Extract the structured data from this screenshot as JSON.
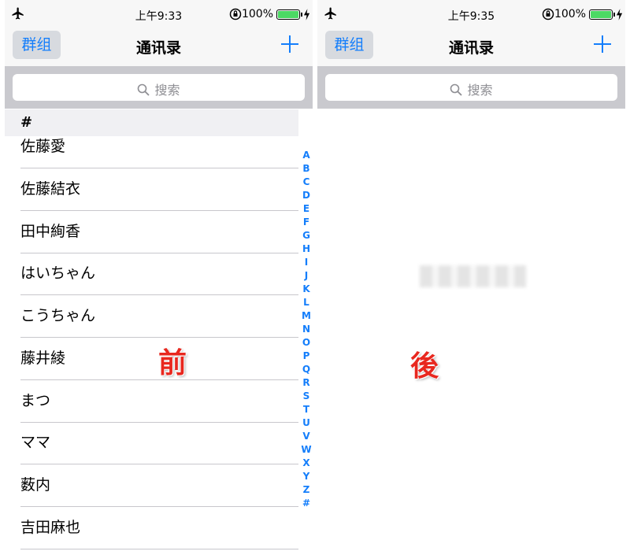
{
  "before": {
    "status": {
      "time": "上午9:33",
      "battery": "100%"
    },
    "nav": {
      "left_button": "群组",
      "title": "通讯录",
      "add_icon": "plus-icon"
    },
    "search": {
      "placeholder": "搜索"
    },
    "section_header": "#",
    "contacts": [
      "佐藤愛",
      "佐藤結衣",
      "田中絢香",
      "はいちゃん",
      "こうちゃん",
      "藤井綾",
      "まつ",
      "ママ",
      "薮内",
      "吉田麻也"
    ],
    "index": [
      "A",
      "B",
      "C",
      "D",
      "E",
      "F",
      "G",
      "H",
      "I",
      "J",
      "K",
      "L",
      "M",
      "N",
      "O",
      "P",
      "Q",
      "R",
      "S",
      "T",
      "U",
      "V",
      "W",
      "X",
      "Y",
      "Z",
      "#"
    ],
    "label": "前"
  },
  "after": {
    "status": {
      "time": "上午9:35",
      "battery": "100%"
    },
    "nav": {
      "left_button": "群组",
      "title": "通讯录",
      "add_icon": "plus-icon"
    },
    "search": {
      "placeholder": "搜索"
    },
    "label": "後"
  },
  "colors": {
    "accent": "#147efb",
    "battery": "#4cd964",
    "label_red": "#e8281f"
  }
}
